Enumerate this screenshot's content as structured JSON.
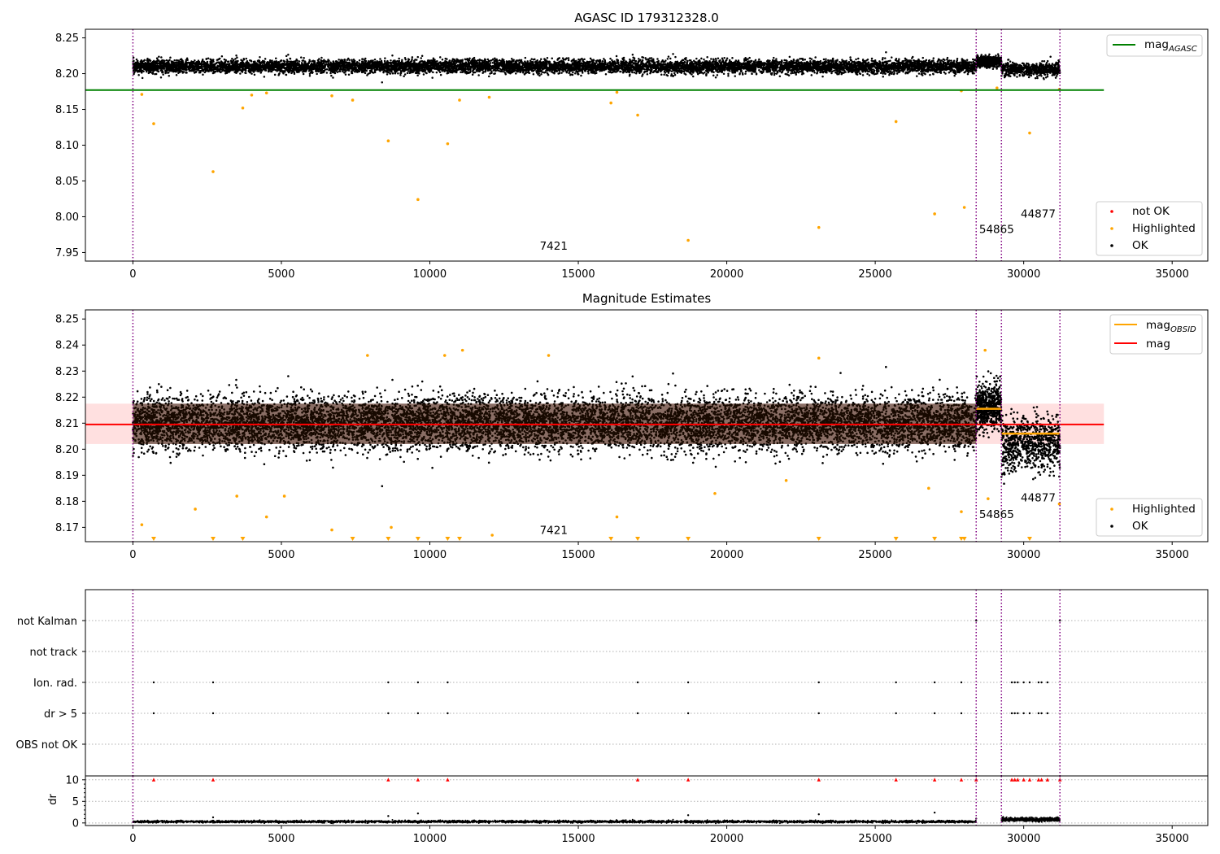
{
  "chart_data": [
    {
      "type": "scatter",
      "title": "AGASC ID 179312328.0",
      "xlim": [
        -1600,
        36200
      ],
      "ylim": [
        7.938,
        8.262
      ],
      "xticks": [
        0,
        5000,
        10000,
        15000,
        20000,
        25000,
        30000,
        35000
      ],
      "yticks": [
        7.95,
        8.0,
        8.05,
        8.1,
        8.15,
        8.2,
        8.25
      ],
      "ytick_labels": [
        "7.95",
        "8.00",
        "8.05",
        "8.10",
        "8.15",
        "8.20",
        "8.25"
      ],
      "vlines": [
        0,
        28400,
        29250,
        31220
      ],
      "hlines": [
        {
          "y": 8.177,
          "x": [
            -1600,
            32700
          ],
          "color": "#008000",
          "label": "AGASC"
        }
      ],
      "bands": [
        {
          "x": [
            0,
            28400
          ],
          "center": 8.21,
          "spread": 0.011
        },
        {
          "x": [
            28400,
            29250
          ],
          "center": 8.2165,
          "spread": 0.009
        },
        {
          "x": [
            29250,
            31220
          ],
          "center": 8.206,
          "spread": 0.011
        }
      ],
      "highlighted": [
        [
          700,
          8.13
        ],
        [
          2700,
          8.063
        ],
        [
          3700,
          8.152
        ],
        [
          4000,
          8.17
        ],
        [
          4500,
          8.173
        ],
        [
          8600,
          8.106
        ],
        [
          9600,
          8.024
        ],
        [
          10600,
          8.102
        ],
        [
          11000,
          8.163
        ],
        [
          12000,
          8.167
        ],
        [
          16100,
          8.159
        ],
        [
          17000,
          8.142
        ],
        [
          16300,
          8.174
        ],
        [
          18700,
          7.967
        ],
        [
          23100,
          7.985
        ],
        [
          25700,
          8.133
        ],
        [
          27000,
          8.004
        ],
        [
          27900,
          8.176
        ],
        [
          28000,
          8.013
        ],
        [
          29100,
          8.18
        ],
        [
          30200,
          8.117
        ],
        [
          31200,
          8.178
        ],
        [
          300,
          8.171
        ],
        [
          7400,
          8.163
        ],
        [
          6700,
          8.169
        ]
      ],
      "annotations": [
        {
          "x": 13700,
          "y": 7.954,
          "text": "7421"
        },
        {
          "x": 28500,
          "y": 7.977,
          "text": "54865"
        },
        {
          "x": 29900,
          "y": 7.999,
          "text": "44877"
        }
      ],
      "legends": [
        {
          "position": "upper right",
          "entries": [
            {
              "kind": "line",
              "color": "#008000",
              "label": "mag",
              "sub": "AGASC"
            }
          ]
        },
        {
          "position": "lower right",
          "entries": [
            {
              "kind": "marker",
              "color": "#ff0000",
              "label": "not OK"
            },
            {
              "kind": "marker",
              "color": "#ffa500",
              "label": "Highlighted"
            },
            {
              "kind": "marker",
              "color": "#000000",
              "label": "OK"
            }
          ]
        }
      ]
    },
    {
      "type": "scatter",
      "title": "Magnitude Estimates",
      "xlim": [
        -1600,
        36200
      ],
      "ylim": [
        8.1645,
        8.2535
      ],
      "xticks": [
        0,
        5000,
        10000,
        15000,
        20000,
        25000,
        30000,
        35000
      ],
      "yticks": [
        8.17,
        8.18,
        8.19,
        8.2,
        8.21,
        8.22,
        8.23,
        8.24,
        8.25
      ],
      "ytick_labels": [
        "8.17",
        "8.18",
        "8.19",
        "8.20",
        "8.21",
        "8.22",
        "8.23",
        "8.24",
        "8.25"
      ],
      "vlines": [
        0,
        28400,
        29250,
        31220
      ],
      "mag": 8.2095,
      "mag_band": [
        8.202,
        8.2175
      ],
      "mag_band_x": [
        -1600,
        32700
      ],
      "mag_obsid": [
        {
          "x": [
            28400,
            29250
          ],
          "y": 8.2155
        },
        {
          "x": [
            29250,
            31220
          ],
          "y": 8.206
        }
      ],
      "bands": [
        {
          "x": [
            0,
            28400
          ],
          "center": 8.21,
          "spread": 0.012
        },
        {
          "x": [
            28400,
            29250
          ],
          "center": 8.2165,
          "spread": 0.01
        },
        {
          "x": [
            29250,
            31220
          ],
          "center": 8.202,
          "spread": 0.012
        }
      ],
      "highlighted": [
        [
          300,
          8.171
        ],
        [
          2100,
          8.177
        ],
        [
          3500,
          8.182
        ],
        [
          4500,
          8.174
        ],
        [
          5100,
          8.182
        ],
        [
          6700,
          8.169
        ],
        [
          8700,
          8.17
        ],
        [
          12100,
          8.167
        ],
        [
          16300,
          8.174
        ],
        [
          19600,
          8.183
        ],
        [
          22000,
          8.188
        ],
        [
          26800,
          8.185
        ],
        [
          27900,
          8.176
        ],
        [
          28800,
          8.181
        ],
        [
          31200,
          8.179
        ],
        [
          7900,
          8.236
        ],
        [
          10500,
          8.236
        ],
        [
          11100,
          8.238
        ],
        [
          14000,
          8.236
        ],
        [
          23100,
          8.235
        ],
        [
          28700,
          8.238
        ]
      ],
      "below_range_x": [
        700,
        2700,
        3700,
        7400,
        8600,
        9600,
        10600,
        11000,
        16100,
        17000,
        18700,
        23100,
        25700,
        27000,
        27900,
        28000,
        30200
      ],
      "annotations": [
        {
          "x": 13700,
          "y": 8.1675,
          "text": "7421"
        },
        {
          "x": 28500,
          "y": 8.1735,
          "text": "54865"
        },
        {
          "x": 29900,
          "y": 8.18,
          "text": "44877"
        }
      ],
      "legends": [
        {
          "position": "upper right",
          "entries": [
            {
              "kind": "line",
              "color": "#ffa500",
              "label": "mag",
              "sub": "OBSID"
            },
            {
              "kind": "line",
              "color": "#ff0000",
              "label": "mag"
            }
          ]
        },
        {
          "position": "lower right",
          "entries": [
            {
              "kind": "marker",
              "color": "#ffa500",
              "label": "Highlighted"
            },
            {
              "kind": "marker",
              "color": "#000000",
              "label": "OK"
            }
          ]
        }
      ]
    },
    {
      "type": "scatter",
      "title": "",
      "xlim": [
        -1600,
        36200
      ],
      "vlines": [
        0,
        28400,
        29250,
        31220
      ],
      "categories": [
        "not Kalman",
        "not track",
        "Ion. rad.",
        "dr > 5",
        "OBS not OK"
      ],
      "flag_points": {
        "not Kalman": [
          28400,
          31220
        ],
        "not track": [],
        "Ion. rad.": [
          700,
          2700,
          8600,
          9600,
          10600,
          17000,
          18700,
          23100,
          25700,
          27000,
          27900,
          29600,
          29700,
          29800,
          30000,
          30200,
          30500,
          30600,
          30800
        ],
        "dr > 5": [
          700,
          2700,
          8600,
          9600,
          10600,
          17000,
          18700,
          23100,
          25700,
          27000,
          27900,
          29600,
          29700,
          29800,
          30000,
          30200,
          30500,
          30600,
          30800
        ],
        "OBS not OK": []
      }
    },
    {
      "type": "scatter",
      "title": "",
      "xlim": [
        -1600,
        36200
      ],
      "ylim": [
        -0.6,
        10.9
      ],
      "yticks": [
        0,
        5,
        10
      ],
      "ytick_labels": [
        "0",
        "5",
        "10"
      ],
      "xticks": [
        0,
        5000,
        10000,
        15000,
        20000,
        25000,
        30000,
        35000
      ],
      "ylabel": "dr",
      "vlines": [
        0,
        28400,
        29250,
        31220
      ],
      "clipped_x": [
        700,
        2700,
        8600,
        9600,
        10600,
        17000,
        18700,
        23100,
        25700,
        27000,
        27900,
        28400,
        29600,
        29700,
        29800,
        30000,
        30200,
        30500,
        30600,
        30800,
        31220
      ],
      "outliers": [
        [
          2700,
          1.3
        ],
        [
          8600,
          1.6
        ],
        [
          9600,
          2.2
        ],
        [
          18700,
          1.8
        ],
        [
          23100,
          2.0
        ],
        [
          27000,
          2.4
        ],
        [
          28400,
          1.0
        ]
      ],
      "bands": [
        {
          "x": [
            0,
            28400
          ],
          "center": 0.3,
          "spread": 0.3
        },
        {
          "x": [
            29250,
            31220
          ],
          "center": 0.8,
          "spread": 0.5
        }
      ]
    }
  ]
}
